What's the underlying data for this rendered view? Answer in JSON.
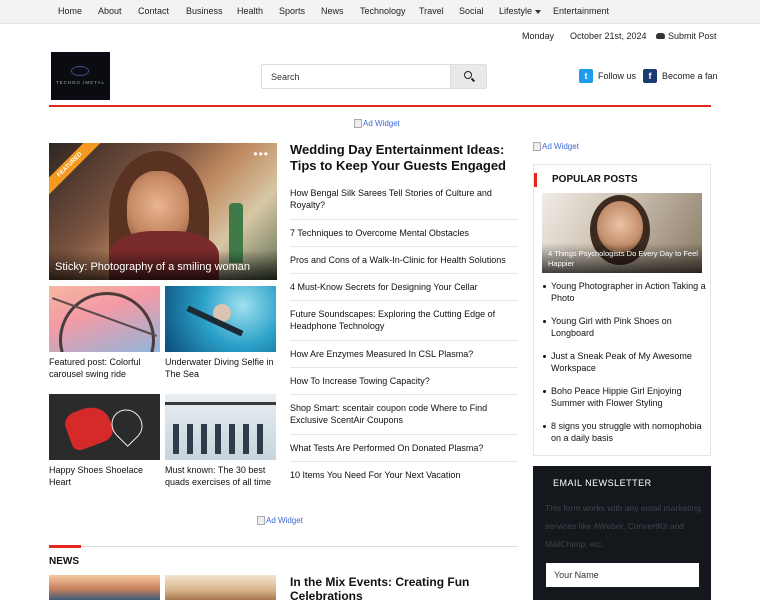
{
  "nav": {
    "items": [
      "Home",
      "About",
      "Contact",
      "Business",
      "Health",
      "Sports",
      "News",
      "Technology",
      "Travel",
      "Social",
      "Lifestyle",
      "Entertainment"
    ]
  },
  "datebar": {
    "day": "Monday",
    "date": "October 21st, 2024",
    "submit_label": "Submit Post",
    "submit_icon": "cloud-upload-icon"
  },
  "header": {
    "logo_text": "TECHNO IMETAL",
    "search_placeholder": "Search",
    "social": {
      "twitter_label": "Follow us",
      "twitter_icon": "twitter-icon",
      "facebook_label": "Become a fan",
      "facebook_icon": "facebook-icon"
    },
    "accent_color": "#e0281f"
  },
  "ads": {
    "top": "Ad Widget",
    "sidebar": "Ad Widget",
    "middle": "Ad Widget"
  },
  "featured": {
    "ribbon": "FEATURED",
    "caption": "Sticky: Photography of a smiling woman"
  },
  "tiles": [
    {
      "title": "Featured post: Colorful carousel swing ride"
    },
    {
      "title": "Underwater Diving Selfie in The Sea"
    },
    {
      "title": "Happy Shoes Shoelace Heart"
    },
    {
      "title": "Must known: The 30 best quads exercises of all time"
    }
  ],
  "headline": "Wedding Day Entertainment Ideas: Tips to Keep Your Guests Engaged",
  "list": [
    "How Bengal Silk Sarees Tell Stories of Culture and Royalty?",
    "7 Techniques to Overcome Mental Obstacles",
    "Pros and Cons of a Walk-In-Clinic for Health Solutions",
    "4 Must-Know Secrets for Designing Your Cellar",
    "Future Soundscapes: Exploring the Cutting Edge of Headphone Technology",
    "How Are Enzymes Measured In CSL Plasma?",
    "How To Increase Towing Capacity?",
    "Shop Smart: scentair coupon code Where to Find Exclusive ScentAir Coupons",
    "What Tests Are Performed On Donated Plasma?",
    "10 Items You Need For Your Next Vacation"
  ],
  "news_section": {
    "title": "NEWS",
    "lead_title": "In the Mix Events: Creating Fun Celebrations"
  },
  "popular": {
    "title": "POPULAR POSTS",
    "hero_caption": "4 Things Psychologists Do Every Day to Feel Happier",
    "items": [
      "Young Photographer in Action Taking a Photo",
      "Young Girl with Pink Shoes on Longboard",
      "Just a Sneak Peak of My Awesome Workspace",
      "Boho Peace Hippie Girl Enjoying Summer with Flower Styling",
      "8 signs you struggle with nomophobia on a daily basis"
    ]
  },
  "newsletter": {
    "title": "EMAIL NEWSLETTER",
    "description": "This form works with any email marketing services like AWeber, ConvertKit and MailChimp, etc.",
    "name_placeholder": "Your Name"
  }
}
